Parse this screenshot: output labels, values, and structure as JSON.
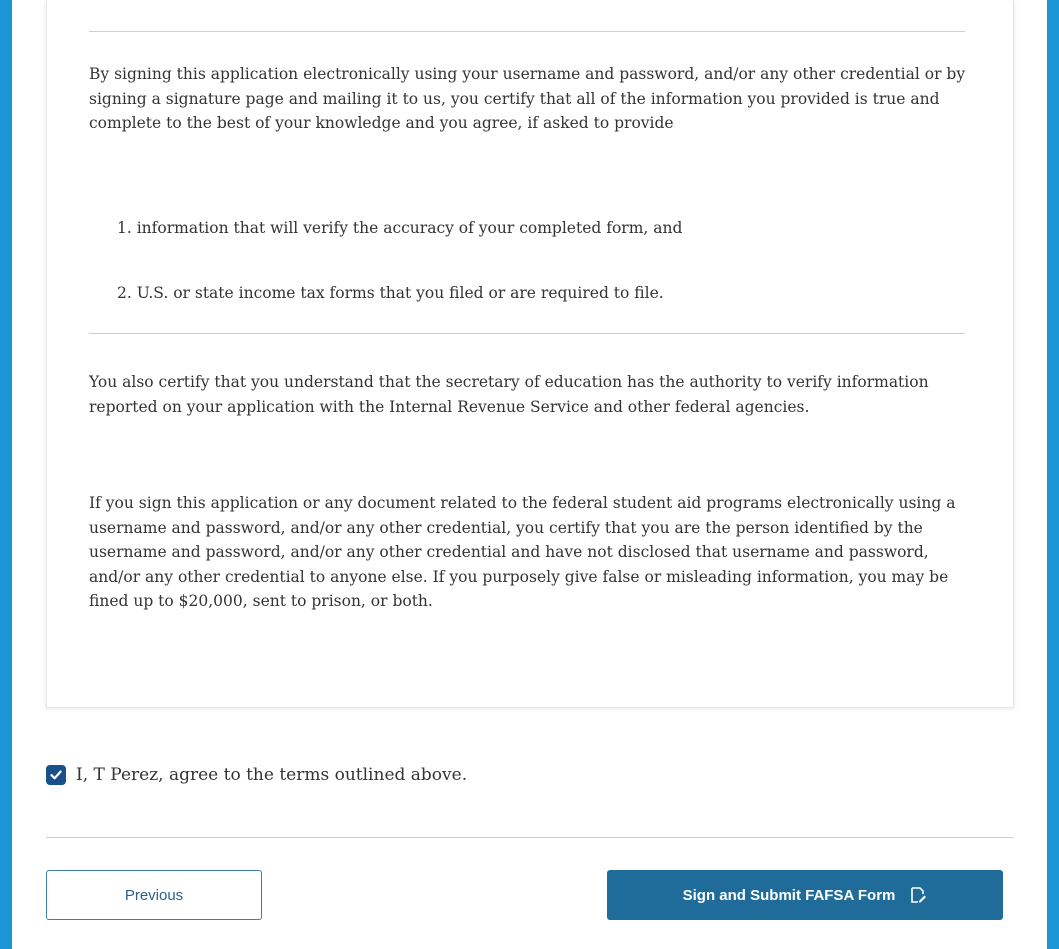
{
  "terms": {
    "paragraph_1": "By signing this application electronically using your username and password, and/or any other credential or by signing a signature page and mailing it to us, you certify that all of the information you provided is true and complete to the best of your knowledge and you agree, if asked to provide",
    "list": [
      "1. information that will verify the accuracy of your completed form, and",
      "2. U.S. or state income tax forms that you filed or are required to file."
    ],
    "paragraph_2": "You also certify that you understand that the secretary of education has the authority to verify information reported on your application with the Internal Revenue Service and other federal agencies.",
    "paragraph_3": "If you sign this application or any document related to the federal student aid programs electronically using a username and password, and/or any other credential, you certify that you are the person identified by the username and password, and/or any other credential and have not disclosed that username and password, and/or any other credential to anyone else. If you purposely give false or misleading information, you may be fined up to $20,000, sent to prison, or both."
  },
  "agreement": {
    "checked": true,
    "label": "I, T Perez, agree to the terms outlined above."
  },
  "actions": {
    "previous_label": "Previous",
    "submit_label": "Sign and Submit FAFSA Form",
    "submit_icon": "sign-document-icon"
  },
  "colors": {
    "frame": "#1a96d4",
    "checkbox": "#1b4f8a",
    "primary_button": "#1f6c9b",
    "secondary_border": "#3a7fa8"
  }
}
